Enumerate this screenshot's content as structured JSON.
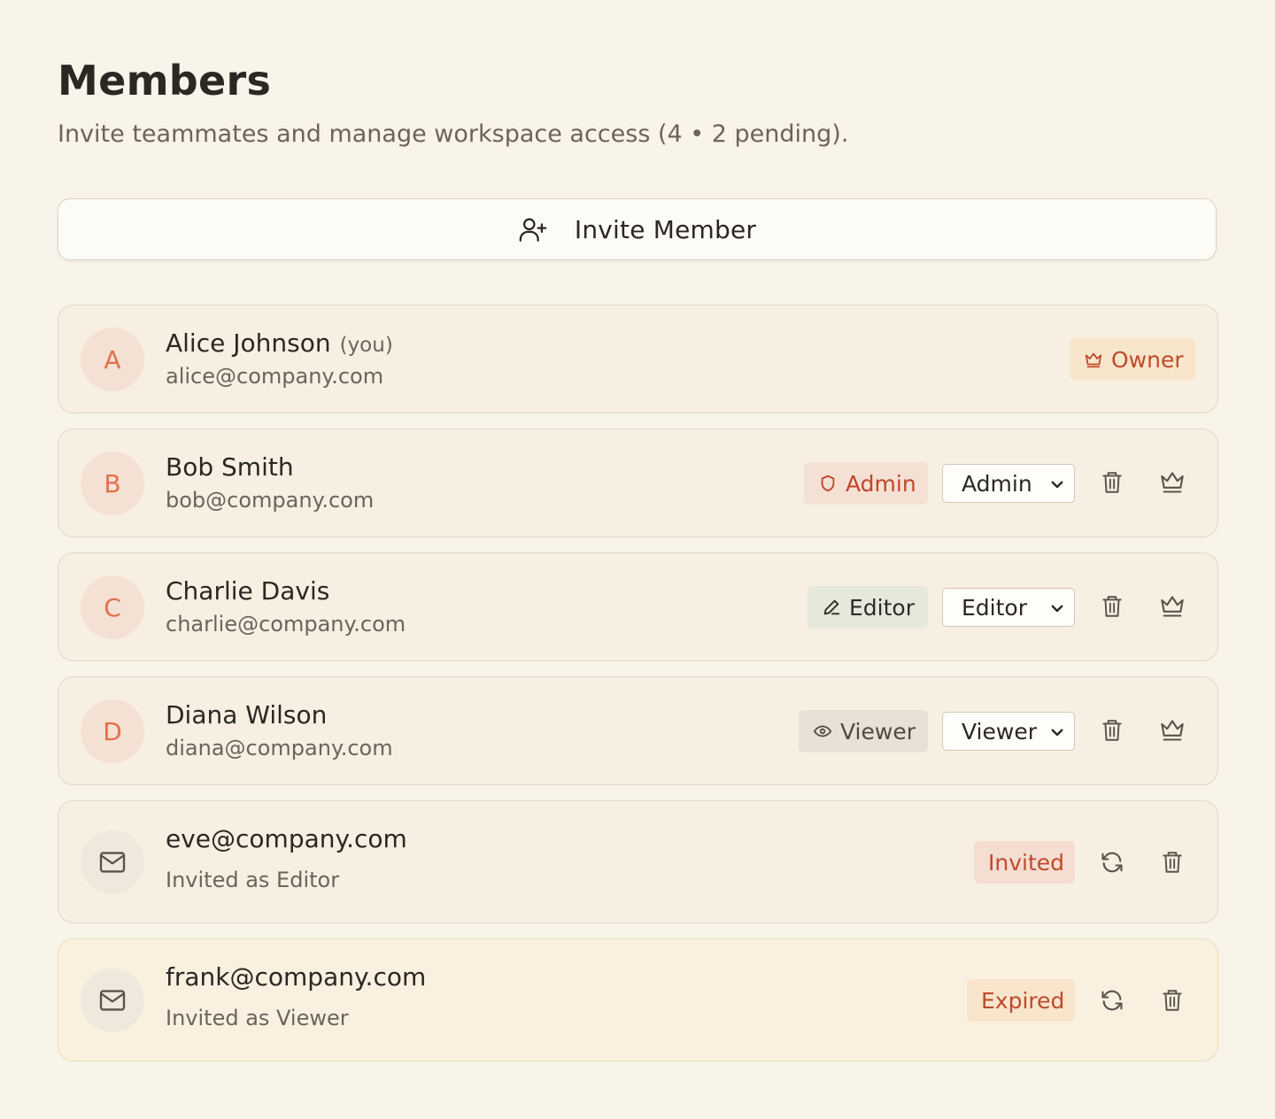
{
  "header": {
    "title": "Members",
    "subtitle": "Invite teammates and manage workspace access (4 • 2 pending)."
  },
  "invite_button": {
    "label": "Invite Member",
    "icon": "user-plus-icon"
  },
  "members": [
    {
      "initial": "A",
      "name": "Alice Johnson",
      "you_label": "(you)",
      "email": "alice@company.com",
      "role_badge": "Owner",
      "badge_icon": "crown-icon"
    },
    {
      "initial": "B",
      "name": "Bob Smith",
      "email": "bob@company.com",
      "role_badge": "Admin",
      "badge_icon": "shield-icon",
      "role_select": "Admin"
    },
    {
      "initial": "C",
      "name": "Charlie Davis",
      "email": "charlie@company.com",
      "role_badge": "Editor",
      "badge_icon": "pencil-icon",
      "role_select": "Editor"
    },
    {
      "initial": "D",
      "name": "Diana Wilson",
      "email": "diana@company.com",
      "role_badge": "Viewer",
      "badge_icon": "eye-icon",
      "role_select": "Viewer"
    }
  ],
  "invites": [
    {
      "email": "eve@company.com",
      "detail": "Invited as Editor",
      "status": "Invited"
    },
    {
      "email": "frank@company.com",
      "detail": "Invited as Viewer",
      "status": "Expired"
    }
  ],
  "colors": {
    "background": "#f8f4ea",
    "card": "#f7efe2",
    "accent": "#e0714a",
    "owner_badge": "#f8e6cc",
    "admin_badge": "#f5e0d4",
    "editor_badge": "#e6e8dc",
    "viewer_badge": "#e7e1d6"
  }
}
